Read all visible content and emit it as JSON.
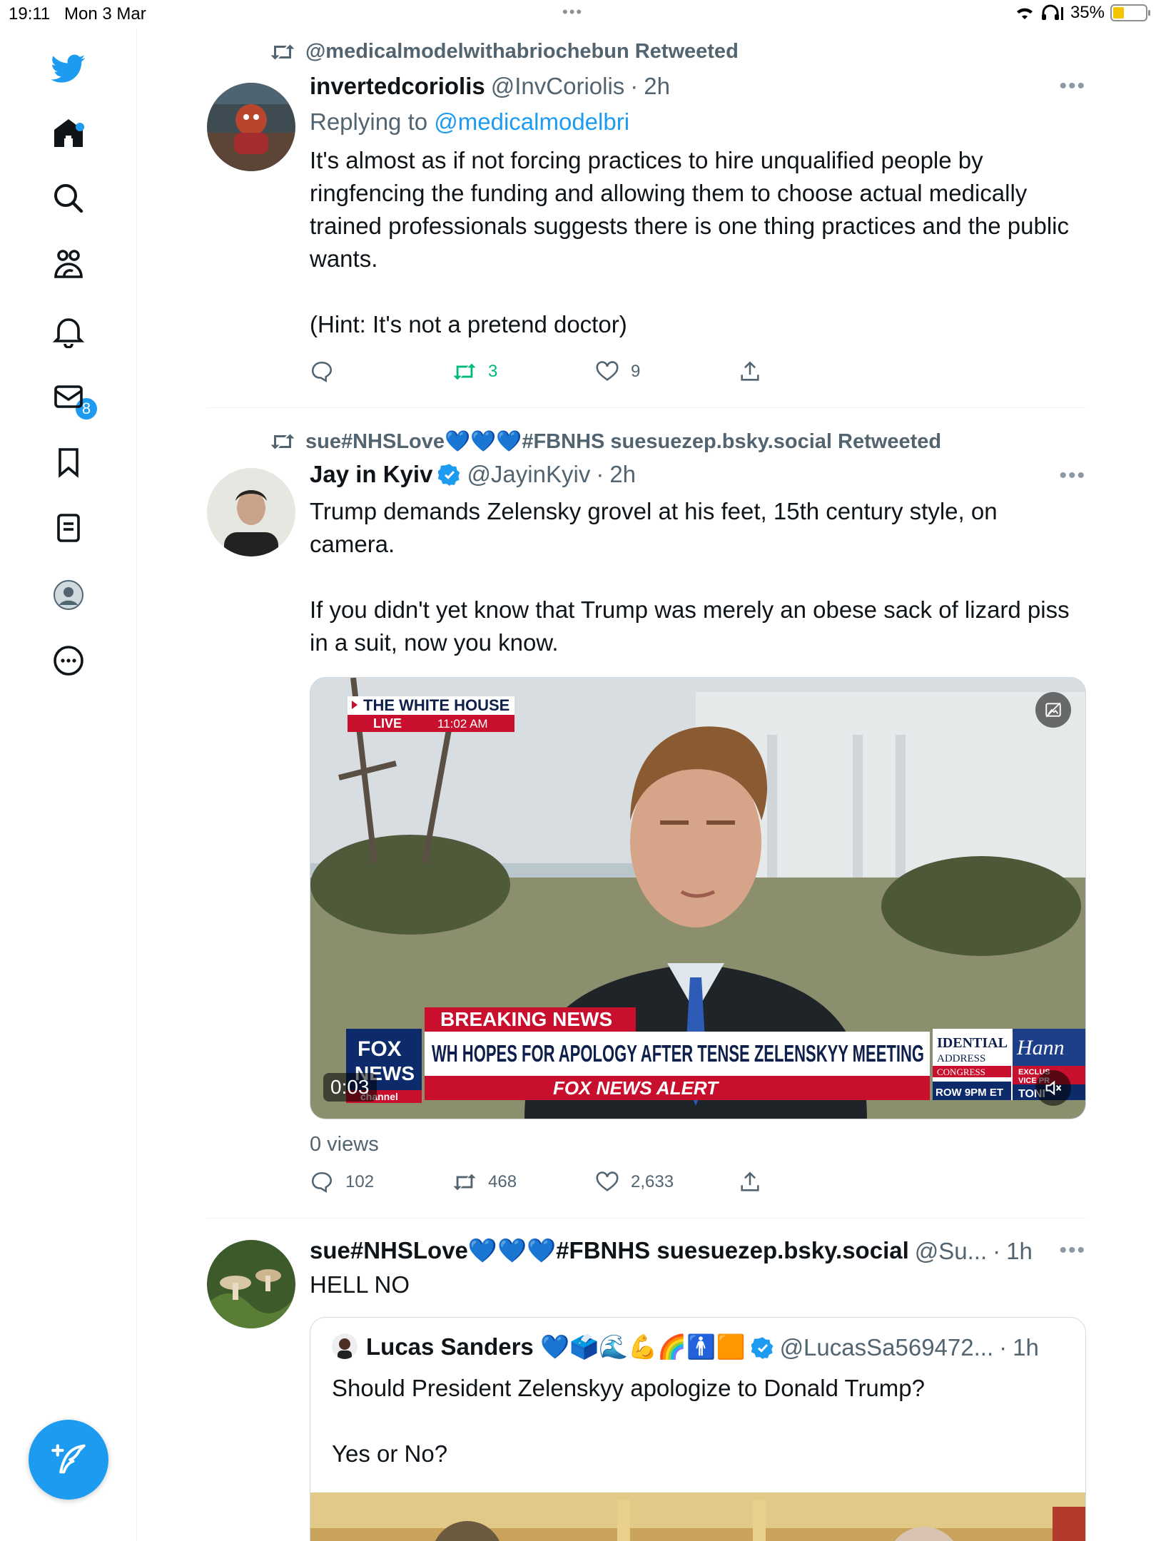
{
  "status_bar": {
    "time": "19:11",
    "date": "Mon 3 Mar",
    "battery": "35%",
    "battery_level": 0.35
  },
  "sidebar": {
    "icons": [
      "twitter-logo-icon",
      "home-icon",
      "search-icon",
      "communities-icon",
      "notifications-icon",
      "messages-icon",
      "bookmarks-icon",
      "lists-icon",
      "profile-icon",
      "more-icon"
    ],
    "notification_count": "8",
    "compose_icon": "compose-icon"
  },
  "tweets": [
    {
      "retweeted_by": "@medicalmodelwithabriochebun Retweeted",
      "name": "invertedcoriolis",
      "handle": "@InvCoriolis",
      "sep": "·",
      "time": "2h",
      "reply_prefix": "Replying to ",
      "reply_to": "@medicalmodelbri",
      "text": "It's almost as if not forcing practices to hire unqualified people by ringfencing the funding and allowing them to choose actual medically trained professionals suggests there is one thing practices and the public wants.\n\n(Hint: It's not a pretend doctor)",
      "replies": "",
      "retweets": "3",
      "likes": "9"
    },
    {
      "retweeted_by": "sue#NHSLove💙💙💙#FBNHS suesuezep.bsky.social Retweeted",
      "name": "Jay in Kyiv",
      "handle": "@JayinKyiv",
      "sep": "·",
      "time": "2h",
      "text": "Trump demands Zelensky grovel at his feet, 15th century style, on camera.\n\nIf you didn't yet know that Trump was merely an obese sack of lizard piss in a suit, now you know.",
      "video": {
        "chyron_location": "THE WHITE HOUSE",
        "chyron_live": "LIVE",
        "chyron_time": "11:02 AM",
        "breaking": "BREAKING NEWS",
        "headline": "WH HOPES FOR APOLOGY AFTER TENSE ZELENSKYY MEETING",
        "alert": "FOX NEWS ALERT",
        "logo_top": "FOX",
        "logo_bottom": "NEWS",
        "logo_sub": "channel",
        "side_1": "IDENTIAL",
        "side_2": "ADDRESS",
        "side_3": "CONGRESS",
        "side_4": "ROW 9PM ET",
        "side_5": "Hann",
        "side_6": "EXCLUS",
        "side_7": "VICE PR",
        "side_8": "TONI",
        "timecode": "0:03"
      },
      "views": "0 views",
      "replies": "102",
      "retweets": "468",
      "likes": "2,633"
    },
    {
      "name": "sue#NHSLove💙💙💙#FBNHS suesuezep.bsky.social",
      "handle": "@Su...",
      "sep": "·",
      "time": "1h",
      "text": "HELL NO",
      "quote": {
        "name": "Lucas Sanders 💙🗳️🌊💪🌈🚹🟧",
        "handle": "@LucasSa569472...",
        "sep": "·",
        "time": "1h",
        "text": "Should President Zelenskyy apologize to Donald Trump?\n\nYes or No?"
      }
    }
  ],
  "colors": {
    "accent": "#1d9bf0",
    "retweet_green": "#00ba7c",
    "secondary_text": "#536471"
  }
}
